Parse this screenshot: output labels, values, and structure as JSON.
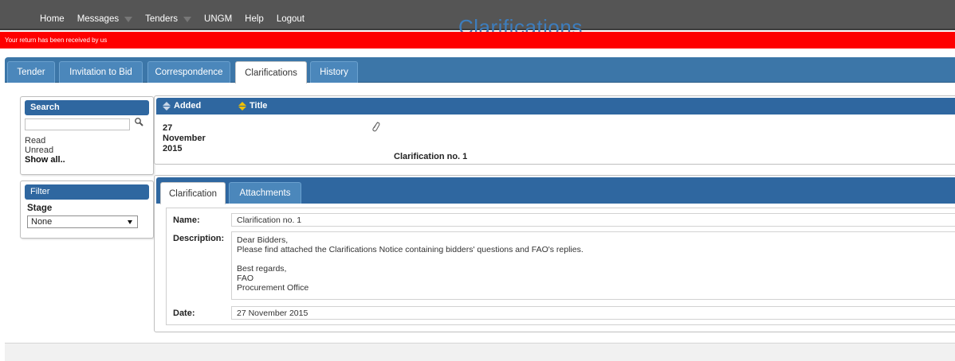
{
  "nav": {
    "items": [
      {
        "label": "Home",
        "has_menu": false
      },
      {
        "label": "Messages",
        "has_menu": true
      },
      {
        "label": "Tenders",
        "has_menu": true
      },
      {
        "label": "UNGM",
        "has_menu": false
      },
      {
        "label": "Help",
        "has_menu": false
      },
      {
        "label": "Logout",
        "has_menu": false
      }
    ]
  },
  "page_heading": "Clarifications",
  "alert": {
    "text": "Your return has been received by us",
    "color": "#fe0000"
  },
  "tabs": {
    "items": [
      {
        "label": "Tender"
      },
      {
        "label": "Invitation to Bid"
      },
      {
        "label": "Correspondence"
      },
      {
        "label": "Clarifications"
      },
      {
        "label": "History"
      }
    ],
    "active": "Clarifications"
  },
  "search": {
    "title": "Search",
    "input_value": "",
    "links": [
      "Read",
      "Unread",
      "Show all.."
    ]
  },
  "filter": {
    "title": "Filter",
    "stage_label": "Stage",
    "stage_value": "None"
  },
  "list": {
    "columns": [
      "Added",
      "Title"
    ],
    "rows": [
      {
        "added_lines": [
          "27",
          "November",
          "2015"
        ],
        "title": "Clarification no. 1",
        "has_attachment": true
      }
    ]
  },
  "detail": {
    "tabs": [
      "Clarification",
      "Attachments"
    ],
    "active_tab": "Clarification",
    "name_label": "Name:",
    "name_value": "Clarification no. 1",
    "description_label": "Description:",
    "description_lines": [
      "Dear Bidders,",
      "Please find attached the Clarifications Notice containing bidders' questions and FAO's replies.",
      "",
      "Best regards,",
      "FAO",
      "Procurement Office"
    ],
    "date_label": "Date:",
    "date_value": "27 November 2015"
  },
  "colors": {
    "topbar": "#555555",
    "accent_blue": "#2f67a0",
    "tab_blue": "#3c76a8",
    "heading_blue": "#3d7dbd"
  }
}
